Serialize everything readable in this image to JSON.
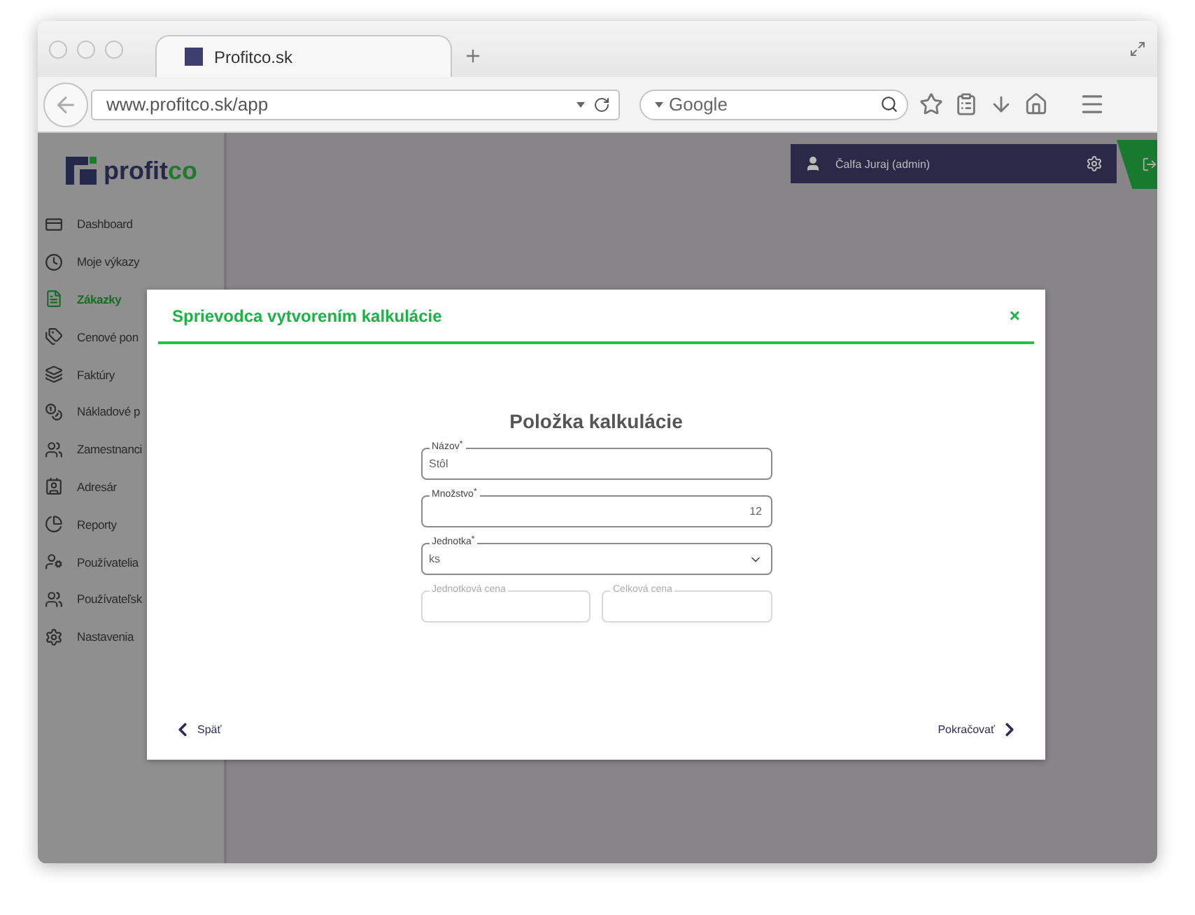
{
  "browser": {
    "tab": {
      "title": "Profitco.sk"
    },
    "url": "www.profitco.sk/app",
    "search": {
      "placeholder": "Google"
    }
  },
  "app": {
    "logo": {
      "part_1": "profit",
      "part_2": "co"
    },
    "sidebar": {
      "items": [
        {
          "label": "Dashboard",
          "selected": false
        },
        {
          "label": "Moje výkazy",
          "selected": false
        },
        {
          "label": "Zákazky",
          "selected": true
        },
        {
          "label": "Cenové pon",
          "selected": false
        },
        {
          "label": "Faktúry",
          "selected": false
        },
        {
          "label": "Nákladové p",
          "selected": false
        },
        {
          "label": "Zamestnanci",
          "selected": false
        },
        {
          "label": "Adresár",
          "selected": false
        },
        {
          "label": "Reporty",
          "selected": false
        },
        {
          "label": "Používatelia",
          "selected": false
        },
        {
          "label": "Používateľsk",
          "selected": false
        },
        {
          "label": "Nastavenia",
          "selected": false
        }
      ]
    },
    "user": {
      "name": "Čalfa Juraj (admin)"
    }
  },
  "dialog": {
    "title": "Sprievodca vytvorením kalkulácie",
    "close": "×",
    "heading": "Položka kalkulácie",
    "fields": [
      {
        "kind": "text",
        "label": "Názov$^{*}$",
        "value": "Stôl",
        "disabled": false
      },
      {
        "kind": "number",
        "label": "Množstvo$^{*}$",
        "value": "12",
        "disabled": false
      },
      {
        "kind": "select",
        "label": "Jednotka$^{*}$",
        "value": "ks",
        "disabled": false
      }
    ],
    "price_fields": [
      {
        "label": "Jednotková cena",
        "disabled": true
      },
      {
        "label": "Celková cena",
        "disabled": true
      }
    ],
    "back": "Späť",
    "next": "Pokračovať"
  }
}
